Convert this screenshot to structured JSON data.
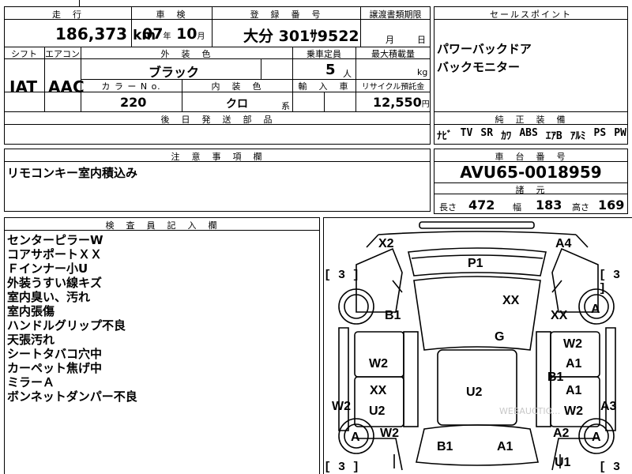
{
  "header": {
    "mileage_label": "走　行",
    "mileage_value": "186,373",
    "mileage_unit": "km",
    "inspection_label": "車　検",
    "inspection_year": "07",
    "inspection_year_unit": "年",
    "inspection_month": "10",
    "inspection_month_unit": "月",
    "registration_label": "登　録　番　号",
    "registration_value": "大分 301ｻ9522",
    "transfer_label": "譲渡書類期限",
    "transfer_month_unit": "月",
    "transfer_day_unit": "日"
  },
  "specs": {
    "shift_label": "シフト",
    "shift_value": "IAT",
    "ac_label": "エアコン",
    "ac_value": "AAC",
    "exterior_color_label": "外　装　色",
    "exterior_color_value": "ブラック",
    "capacity_label": "乗車定員",
    "capacity_value": "5",
    "capacity_unit": "人",
    "max_load_label": "最大積載量",
    "max_load_unit": "kg",
    "color_no_label": "カ ラ ー  N o.",
    "color_no_value": "220",
    "interior_color_label": "内　装　色",
    "interior_color_value": "クロ",
    "interior_color_suffix": "系",
    "import_label": "輸　入　車",
    "recycle_label": "リサイクル預託金",
    "recycle_value": "12,550",
    "recycle_unit": "円",
    "later_parts_label": "後　日　発　送　部　品"
  },
  "sales_points": {
    "label": "セールスポイント",
    "items": [
      "パワーバックドア",
      "バックモニター"
    ]
  },
  "equipment": {
    "label": "純　正　装　備",
    "items": [
      "ﾅﾋﾞ",
      "TV",
      "SR",
      "ｶﾜ",
      "ABS",
      "ｴｱB",
      "ｱﾙﾐ",
      "PS",
      "PW"
    ]
  },
  "notes": {
    "label": "注　意　事　項　欄",
    "text": "リモコンキー室内積込み"
  },
  "chassis": {
    "label": "車　台　番　号",
    "value": "AVU65-0018959",
    "dims_label": "諸　元",
    "length_label": "長さ",
    "length_value": "472",
    "width_label": "幅",
    "width_value": "183",
    "height_label": "高さ",
    "height_value": "169"
  },
  "inspector": {
    "label": "検　査　員　記　入　欄",
    "lines": [
      "センターピラーW",
      "コアサポートＸＸ",
      "Ｆインナー小U",
      "外装うすい線キズ",
      "室内臭い、汚れ",
      "室内張傷",
      "ハンドルグリップ不良",
      "天張汚れ",
      "シートタバコ穴中",
      "カーペット焦げ中",
      "ミラーＡ",
      "ボンネットダンパー不良"
    ]
  },
  "diagram": {
    "tire_brackets": [
      "[ 3 ]",
      "[ 3 ]",
      "[ 3 ]",
      "[ 3 ]"
    ],
    "marks": [
      "X2",
      "A4",
      "P1",
      "XX",
      "B1",
      "XX",
      "A",
      "G",
      "W2",
      "W2",
      "A1",
      "A1",
      "B1",
      "XX",
      "A1",
      "U2",
      "U2",
      "W2",
      "W2",
      "A3",
      "A",
      "W2",
      "A2",
      "A",
      "B1",
      "A1",
      "U1"
    ],
    "watermark": "WEBAUCTIO..."
  }
}
